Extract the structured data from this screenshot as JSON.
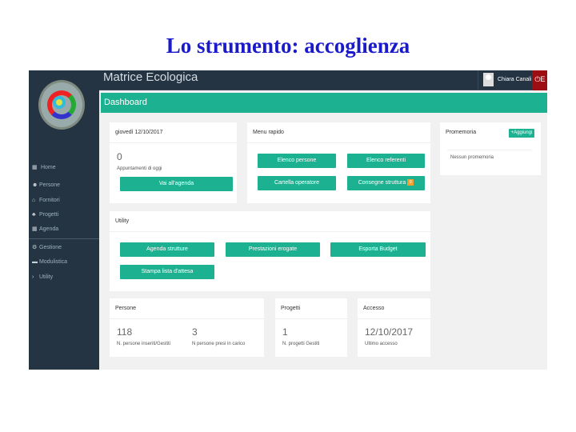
{
  "slide_title": "Lo strumento: accoglienza",
  "app": {
    "brand": "Matrice Ecologica",
    "user": "Chiara Canali",
    "logout": "E",
    "page_title": "Dashboard"
  },
  "sidebar": {
    "items": [
      {
        "label": "Home",
        "icon": "calendar-icon"
      },
      {
        "label": "Persone",
        "icon": "users-icon"
      },
      {
        "label": "Fornitori",
        "icon": "bank-icon"
      },
      {
        "label": "Progetti",
        "icon": "cubes-icon"
      },
      {
        "label": "Agenda",
        "icon": "calendar-icon"
      },
      {
        "label": "Gestione",
        "icon": "gears-icon"
      },
      {
        "label": "Modulistica",
        "icon": "folder-icon"
      },
      {
        "label": "Utility",
        "icon": "chevron-right-icon"
      }
    ]
  },
  "today": {
    "title": "giovedì 12/10/2017",
    "count": "0",
    "caption": "Appuntamenti di oggi",
    "button": "Vai all'agenda"
  },
  "menu_rapido": {
    "title": "Menu rapido",
    "buttons": [
      "Elenco persone",
      "Elenco referenti",
      "Cartella operatore",
      "Consegne struttura"
    ],
    "badge": "0"
  },
  "promemoria": {
    "title": "Promemoria",
    "add": "Aggiungi",
    "empty": "Nessun promemoria"
  },
  "utility": {
    "title": "Utility",
    "buttons": [
      "Agenda strutture",
      "Prestazioni erogate",
      "Esporta Budget",
      "Stampa lista d'attesa"
    ]
  },
  "persone": {
    "title": "Persone",
    "v1": "118",
    "l1": "N. persone inseriti/Gestiti",
    "v2": "3",
    "l2": "N persone presi in carico"
  },
  "progetti": {
    "title": "Progetti",
    "v": "1",
    "l": "N. progetti Gestiti"
  },
  "accesso": {
    "title": "Accesso",
    "v": "12/10/2017",
    "l": "Ultimo accesso"
  }
}
